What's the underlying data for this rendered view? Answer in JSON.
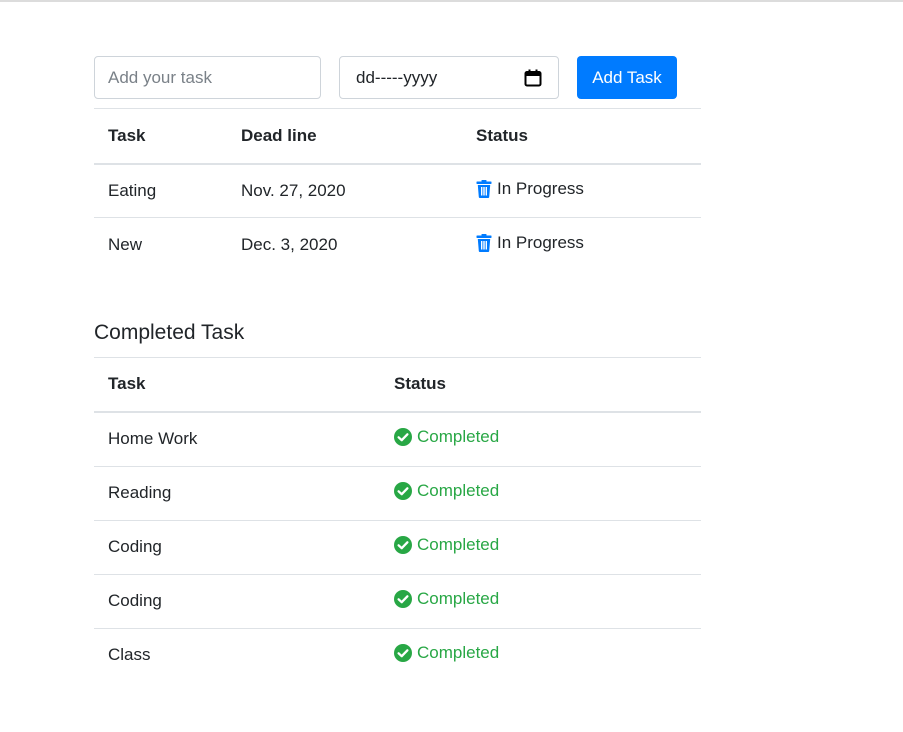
{
  "form": {
    "task_placeholder": "Add your task",
    "date_placeholder": "dd-----yyyy",
    "add_button_label": "Add Task"
  },
  "active_tasks": {
    "headers": {
      "task": "Task",
      "deadline": "Dead line",
      "status": "Status"
    },
    "rows": [
      {
        "task": "Eating",
        "deadline": "Nov. 27, 2020",
        "status": "In Progress"
      },
      {
        "task": "New",
        "deadline": "Dec. 3, 2020",
        "status": "In Progress"
      }
    ]
  },
  "completed": {
    "title": "Completed Task",
    "headers": {
      "task": "Task",
      "status": "Status"
    },
    "rows": [
      {
        "task": "Home Work",
        "status": "Completed"
      },
      {
        "task": "Reading",
        "status": "Completed"
      },
      {
        "task": "Coding",
        "status": "Completed"
      },
      {
        "task": "Coding",
        "status": "Completed"
      },
      {
        "task": "Class",
        "status": "Completed"
      }
    ]
  },
  "icons": {
    "delete": "trash-icon",
    "done": "check-circle-icon",
    "date": "calendar-icon"
  },
  "colors": {
    "primary": "#007bff",
    "success": "#28a745",
    "border": "#dee2e6"
  }
}
